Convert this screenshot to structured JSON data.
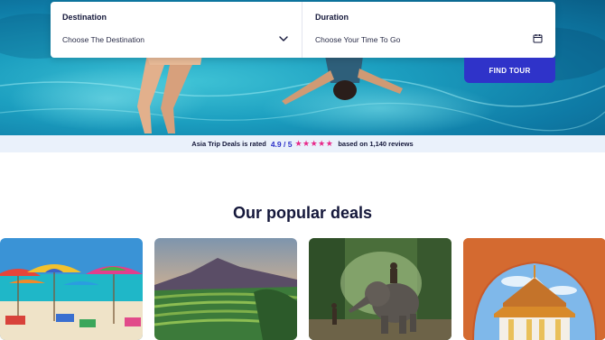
{
  "search": {
    "destination_label": "Destination",
    "destination_value": "Choose The Destination",
    "duration_label": "Duration",
    "duration_value": "Choose Your Time To Go",
    "find_button": "FIND TOUR"
  },
  "rating": {
    "prefix": "Asia Trip Deals is rated",
    "score": "4.9 / 5",
    "stars": "★★★★★",
    "star_value": 5,
    "suffix": "based on 1,140 reviews"
  },
  "section": {
    "title": "Our popular deals"
  },
  "colors": {
    "accent": "#2f33c9",
    "star": "#e8288a",
    "rating_bg": "#eaf1fb",
    "heading": "#14173a"
  },
  "icons": {
    "destination_dropdown": "chevron-down-icon",
    "duration_picker": "calendar-icon"
  },
  "deals": [
    {
      "image": "beach-umbrellas-photo"
    },
    {
      "image": "volcano-rice-terraces-photo"
    },
    {
      "image": "elephant-jungle-photo"
    },
    {
      "image": "thai-temple-photo"
    }
  ]
}
